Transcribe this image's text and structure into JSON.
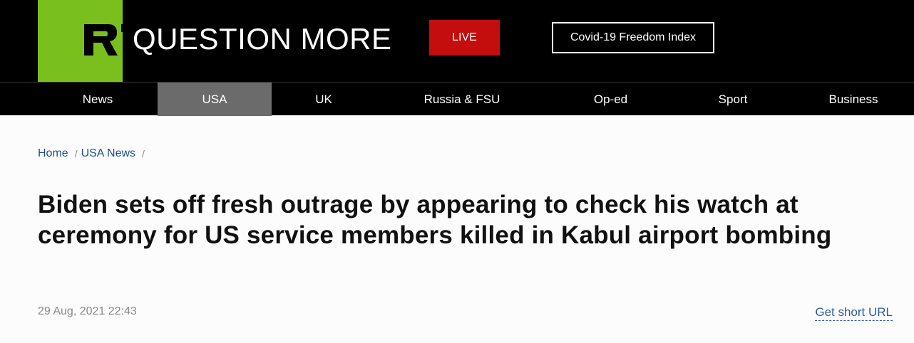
{
  "header": {
    "logo_text": "RT",
    "tagline": "QUESTION MORE",
    "live_label": "LIVE",
    "covid_label": "Covid-19 Freedom Index",
    "colors": {
      "brand_green": "#79c01e",
      "live_red": "#c40d0d"
    }
  },
  "nav": {
    "items": [
      {
        "label": "News"
      },
      {
        "label": "USA",
        "active": true
      },
      {
        "label": "UK"
      },
      {
        "label": "Russia & FSU"
      },
      {
        "label": "Op-ed"
      },
      {
        "label": "Sport"
      },
      {
        "label": "Business"
      }
    ]
  },
  "breadcrumb": {
    "home": "Home",
    "section": "USA News"
  },
  "article": {
    "headline": "Biden sets off fresh outrage by appearing to check his watch at ceremony for US service members killed in Kabul airport bombing",
    "date": "29 Aug, 2021 22:43",
    "short_url_label": "Get short URL"
  }
}
